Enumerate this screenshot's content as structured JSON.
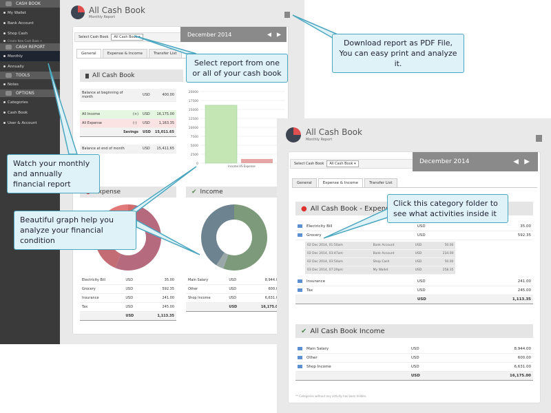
{
  "sidebar": {
    "sections": [
      {
        "label": "CASH BOOK",
        "items": [
          "My Wallet",
          "Bank Account",
          "Shop Cash"
        ],
        "small": "Create New Cash Book +"
      },
      {
        "label": "CASH REPORT",
        "items": [
          "Monthly",
          "Annually"
        ]
      },
      {
        "label": "TOOLS",
        "items": [
          "Notes"
        ]
      },
      {
        "label": "OPTIONS",
        "items": [
          "Categories",
          "Cash Book",
          "User & Account"
        ]
      }
    ]
  },
  "report": {
    "title": "All Cash Book",
    "subtitle": "Monthly Report",
    "select_label": "Select Cash Book",
    "select_value": "All Cash Book",
    "month": "December 2014",
    "tabs": [
      "General",
      "Expense & Income",
      "Transfer List"
    ],
    "book_header": "All Cash Book",
    "balance_begin": {
      "label": "Balance at beginning of month",
      "cur": "USD",
      "val": "400.00"
    },
    "income": {
      "label": "All Income",
      "sign": "(+)",
      "cur": "USD",
      "val": "16,175.00"
    },
    "expense": {
      "label": "All Expense",
      "sign": "(-)",
      "cur": "USD",
      "val": "1,163.35"
    },
    "savings": {
      "label": "Savings",
      "cur": "USD",
      "val": "15,011.65"
    },
    "balance_end": {
      "label": "Balance at end of month",
      "cur": "USD",
      "val": "15,411.65"
    },
    "expense_title": "Expense",
    "income_title": "Income",
    "expense_rows": [
      [
        "Electricity Bill",
        "USD",
        "35.00"
      ],
      [
        "Grocery",
        "USD",
        "592.35"
      ],
      [
        "Insurance",
        "USD",
        "241.00"
      ],
      [
        "Tax",
        "USD",
        "245.00"
      ]
    ],
    "expense_total": [
      "USD",
      "1,113.35"
    ],
    "income_rows": [
      [
        "Main Salary",
        "USD",
        "8,944.00"
      ],
      [
        "Other",
        "USD",
        "600.00"
      ],
      [
        "Shop Income",
        "USD",
        "6,631.00"
      ]
    ],
    "income_total": [
      "USD",
      "16,175.00"
    ],
    "expense_header": "All Cash Book - Expense",
    "income_header": "All Cash Book Income",
    "grocery_detail": [
      [
        "02 Dec 2014, 01:50am",
        "Bank Account",
        "USD",
        "50.00"
      ],
      [
        "02 Dec 2014, 03:47am",
        "Bank Account",
        "USD",
        "234.00"
      ],
      [
        "02 Dec 2014, 03:54am",
        "Shop Cash",
        "USD",
        "50.00"
      ],
      [
        "03 Dec 2014, 07:29pm",
        "My Wallet",
        "USD",
        "258.35"
      ]
    ],
    "footnote": "** Categories without any activity has been hidden."
  },
  "chart_data": [
    {
      "type": "bar",
      "categories": [
        "Income VS Expense"
      ],
      "series": [
        {
          "values": [
            16175
          ],
          "color": "#c3e6b4"
        },
        {
          "values": [
            1163.35
          ],
          "color": "#e6a5a5"
        }
      ],
      "yticks": [
        "0",
        "2500",
        "5000",
        "7500",
        "10000",
        "12500",
        "15000",
        "17500",
        "20000"
      ],
      "ylim": [
        0,
        20000
      ],
      "xlabel": "Income VS Expense"
    },
    {
      "type": "pie",
      "title": "Expense",
      "labels": [
        "Electricity Bill",
        "Grocery",
        "Insurance",
        "Tax"
      ],
      "values": [
        35,
        592.35,
        241,
        245
      ],
      "colors": [
        "#d46b6b",
        "#b56a7e",
        "#c46c73",
        "#e07a7a"
      ]
    },
    {
      "type": "pie",
      "title": "Income",
      "labels": [
        "Main Salary",
        "Other",
        "Shop Income"
      ],
      "values": [
        8944,
        600,
        6631
      ],
      "colors": [
        "#7d9a7a",
        "#9aa8a8",
        "#6d8490"
      ]
    }
  ],
  "callouts": {
    "select": "Select report from one or all of your cash book",
    "pdf": "Download report as PDF File, You can easy print and analyze it.",
    "watch": "Watch your monthly and annually financial report",
    "graph": "Beautiful graph help you analyze your financial condition",
    "folder": "Click this category folder to see what activities inside it"
  }
}
